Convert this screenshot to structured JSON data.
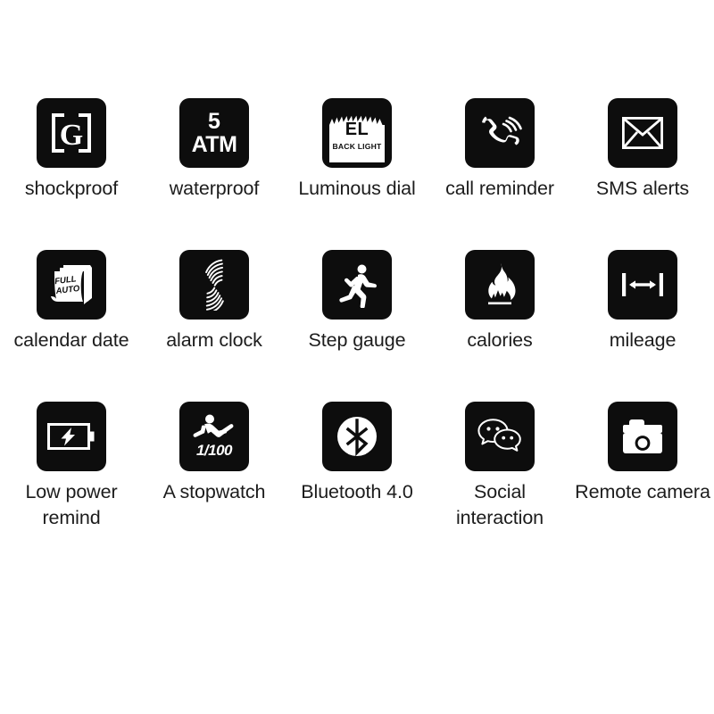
{
  "page": {
    "background_color": "#ffffff",
    "tile_color": "#0d0d0d",
    "label_color": "#1c1c1c",
    "columns": 5,
    "rows": 3
  },
  "features": [
    {
      "id": "shockproof",
      "icon": "shockproof-g-icon",
      "label": "shockproof",
      "icon_text": "G"
    },
    {
      "id": "waterproof",
      "icon": "water-resistance-5atm-icon",
      "label": "waterproof",
      "icon_text_top": "5",
      "icon_text_bottom": "ATM"
    },
    {
      "id": "luminous-dial",
      "icon": "el-backlight-icon",
      "label": "Luminous dial",
      "icon_text_top": "EL",
      "icon_text_bottom": "BACK LIGHT"
    },
    {
      "id": "call-reminder",
      "icon": "phone-handset-icon",
      "label": "call reminder"
    },
    {
      "id": "sms-alerts",
      "icon": "envelope-icon",
      "label": "SMS alerts"
    },
    {
      "id": "calendar-date",
      "icon": "calendar-pages-icon",
      "label": "calendar date",
      "icon_text_top": "FULL",
      "icon_text_bottom": "AUTO"
    },
    {
      "id": "alarm-clock",
      "icon": "vibration-waves-icon",
      "label": "alarm clock"
    },
    {
      "id": "step-gauge",
      "icon": "running-person-icon",
      "label": "Step gauge"
    },
    {
      "id": "calories",
      "icon": "flame-icon",
      "label": "calories"
    },
    {
      "id": "mileage",
      "icon": "distance-measure-icon",
      "label": "mileage"
    },
    {
      "id": "low-power-remind",
      "icon": "battery-bolt-icon",
      "label": "Low power remind"
    },
    {
      "id": "a-stopwatch",
      "icon": "sprinter-stopwatch-icon",
      "label": "A stopwatch",
      "icon_text": "1/100"
    },
    {
      "id": "bluetooth",
      "icon": "bluetooth-icon",
      "label": "Bluetooth 4.0"
    },
    {
      "id": "social-interaction",
      "icon": "chat-bubbles-icon",
      "label": "Social interaction"
    },
    {
      "id": "remote-camera",
      "icon": "camera-icon",
      "label": "Remote camera"
    }
  ]
}
